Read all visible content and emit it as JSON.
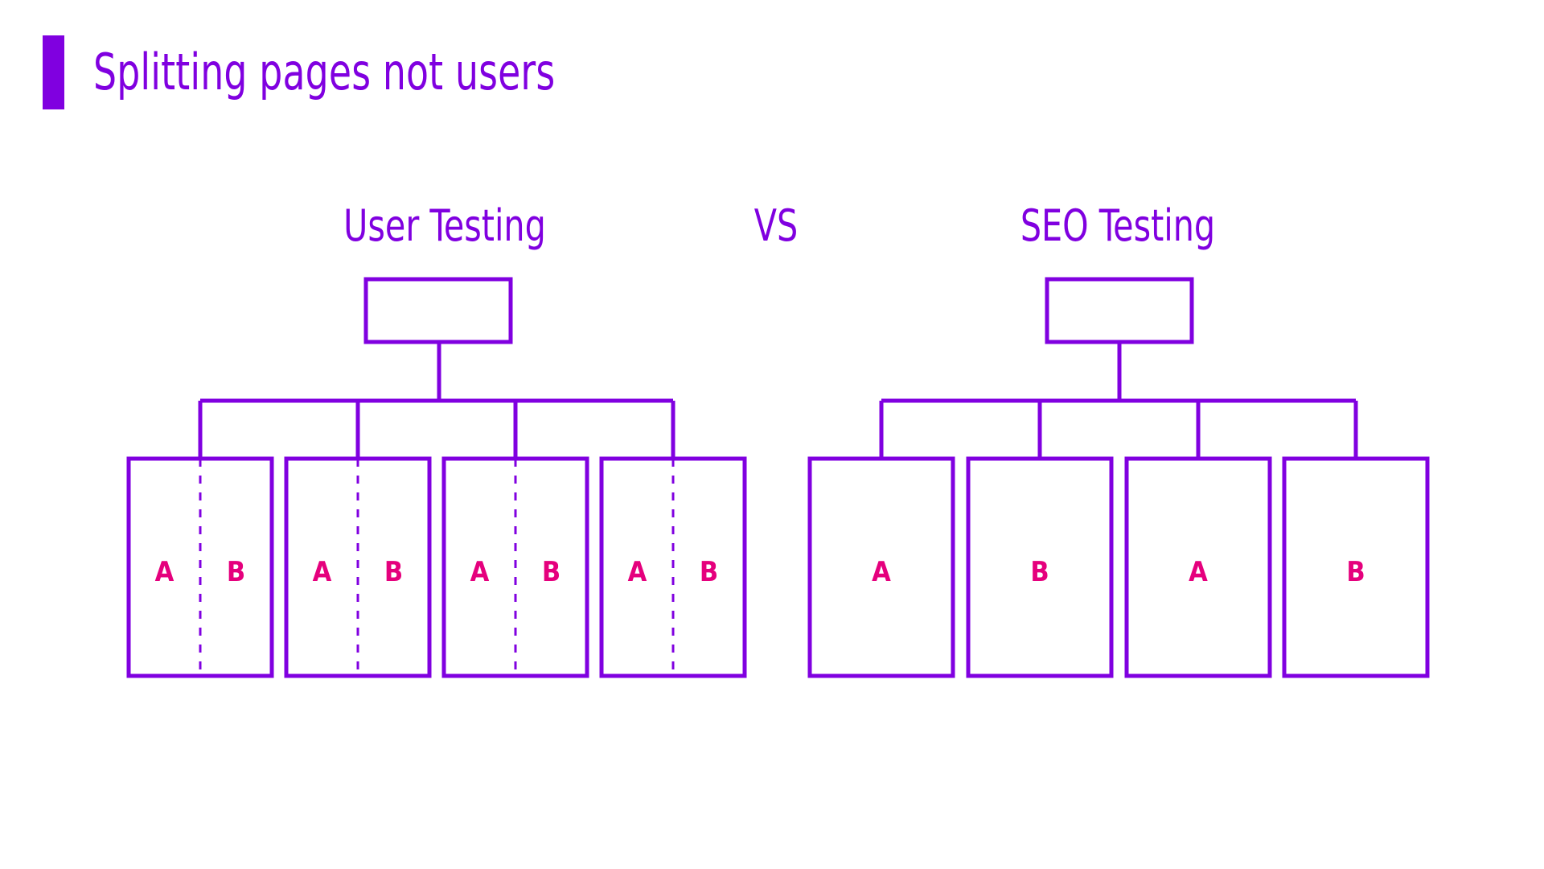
{
  "slide": {
    "title": "Splitting pages not users",
    "accent_color": "#8000e0",
    "label_color": "#e5007d",
    "background_color": "#ffffff"
  },
  "headings": {
    "left": "User Testing",
    "divider": "VS",
    "right": "SEO Testing"
  },
  "diagrams": {
    "user_testing": {
      "name": "User Testing",
      "root": {
        "label": ""
      },
      "split_mode": "within-page",
      "pages": [
        {
          "left_label": "A",
          "right_label": "B"
        },
        {
          "left_label": "A",
          "right_label": "B"
        },
        {
          "left_label": "A",
          "right_label": "B"
        },
        {
          "left_label": "A",
          "right_label": "B"
        }
      ]
    },
    "seo_testing": {
      "name": "SEO Testing",
      "root": {
        "label": ""
      },
      "split_mode": "whole-page",
      "pages": [
        {
          "label": "A"
        },
        {
          "label": "B"
        },
        {
          "label": "A"
        },
        {
          "label": "B"
        }
      ]
    }
  }
}
